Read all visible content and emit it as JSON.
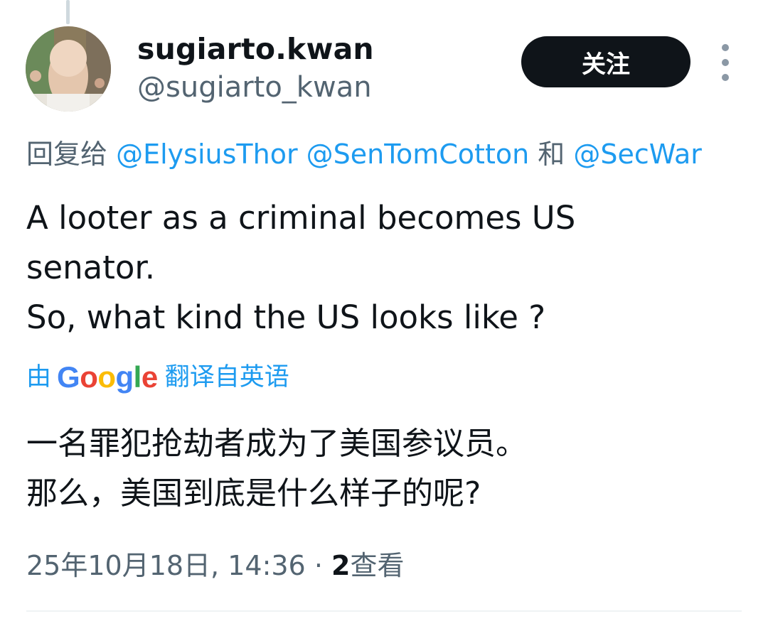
{
  "author": {
    "display_name": "sugiarto.kwan",
    "handle": "@sugiarto_kwan",
    "avatar_icon": "avatar-photo-bald-man"
  },
  "follow_button": {
    "label": "关注"
  },
  "more_button": {
    "icon": "more-vertical-icon"
  },
  "reply_to": {
    "prefix": "回复给",
    "mention_1": "@ElysiusThor",
    "mention_2": "@SenTomCotton",
    "joiner": "和",
    "mention_3": "@SecWar"
  },
  "tweet": {
    "lines": [
      "A looter as a criminal becomes US",
      "senator.",
      "So, what kind the US looks like ?"
    ]
  },
  "translation": {
    "by_prefix": "由",
    "provider": "Google",
    "suffix": "翻译自英语",
    "lines": [
      "一名罪犯抢劫者成为了美国参议员。",
      "那么，美国到底是什么样子的呢?"
    ]
  },
  "meta": {
    "timestamp": "25年10月18日, 14:36",
    "separator": "·",
    "views_count": "2",
    "views_label": "查看"
  },
  "colors": {
    "link": "#1d9bf0",
    "secondary_text": "#536471",
    "primary_text": "#0f1419",
    "button_bg": "#0f1419",
    "google_blue": "#4285f4",
    "google_red": "#ea4335",
    "google_yellow": "#fbbc05",
    "google_green": "#34a853"
  }
}
